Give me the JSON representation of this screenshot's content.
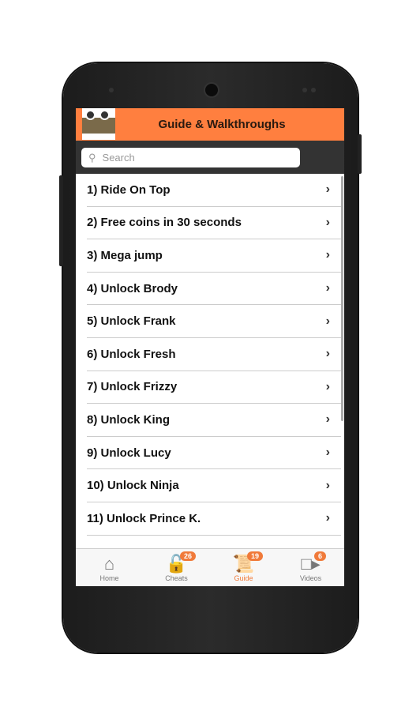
{
  "header": {
    "title": "Guide & Walkthroughs"
  },
  "search": {
    "placeholder": "Search"
  },
  "items": [
    "1) Ride On Top",
    "2) Free coins in 30 seconds",
    "3) Mega jump",
    "4) Unlock Brody",
    "5) Unlock Frank",
    "6) Unlock Fresh",
    "7) Unlock Frizzy",
    "8) Unlock King",
    "9) Unlock Lucy",
    "10) Unlock Ninja",
    "11) Unlock Prince K."
  ],
  "tabs": [
    {
      "label": "Home",
      "icon": "home-icon"
    },
    {
      "label": "Cheats",
      "icon": "unlock-icon",
      "badge": "26"
    },
    {
      "label": "Guide",
      "icon": "scroll-icon",
      "badge": "19",
      "active": true
    },
    {
      "label": "Videos",
      "icon": "video-icon",
      "badge": "6"
    }
  ],
  "colors": {
    "accent": "#ff7f3f",
    "searchbar": "#333333"
  }
}
